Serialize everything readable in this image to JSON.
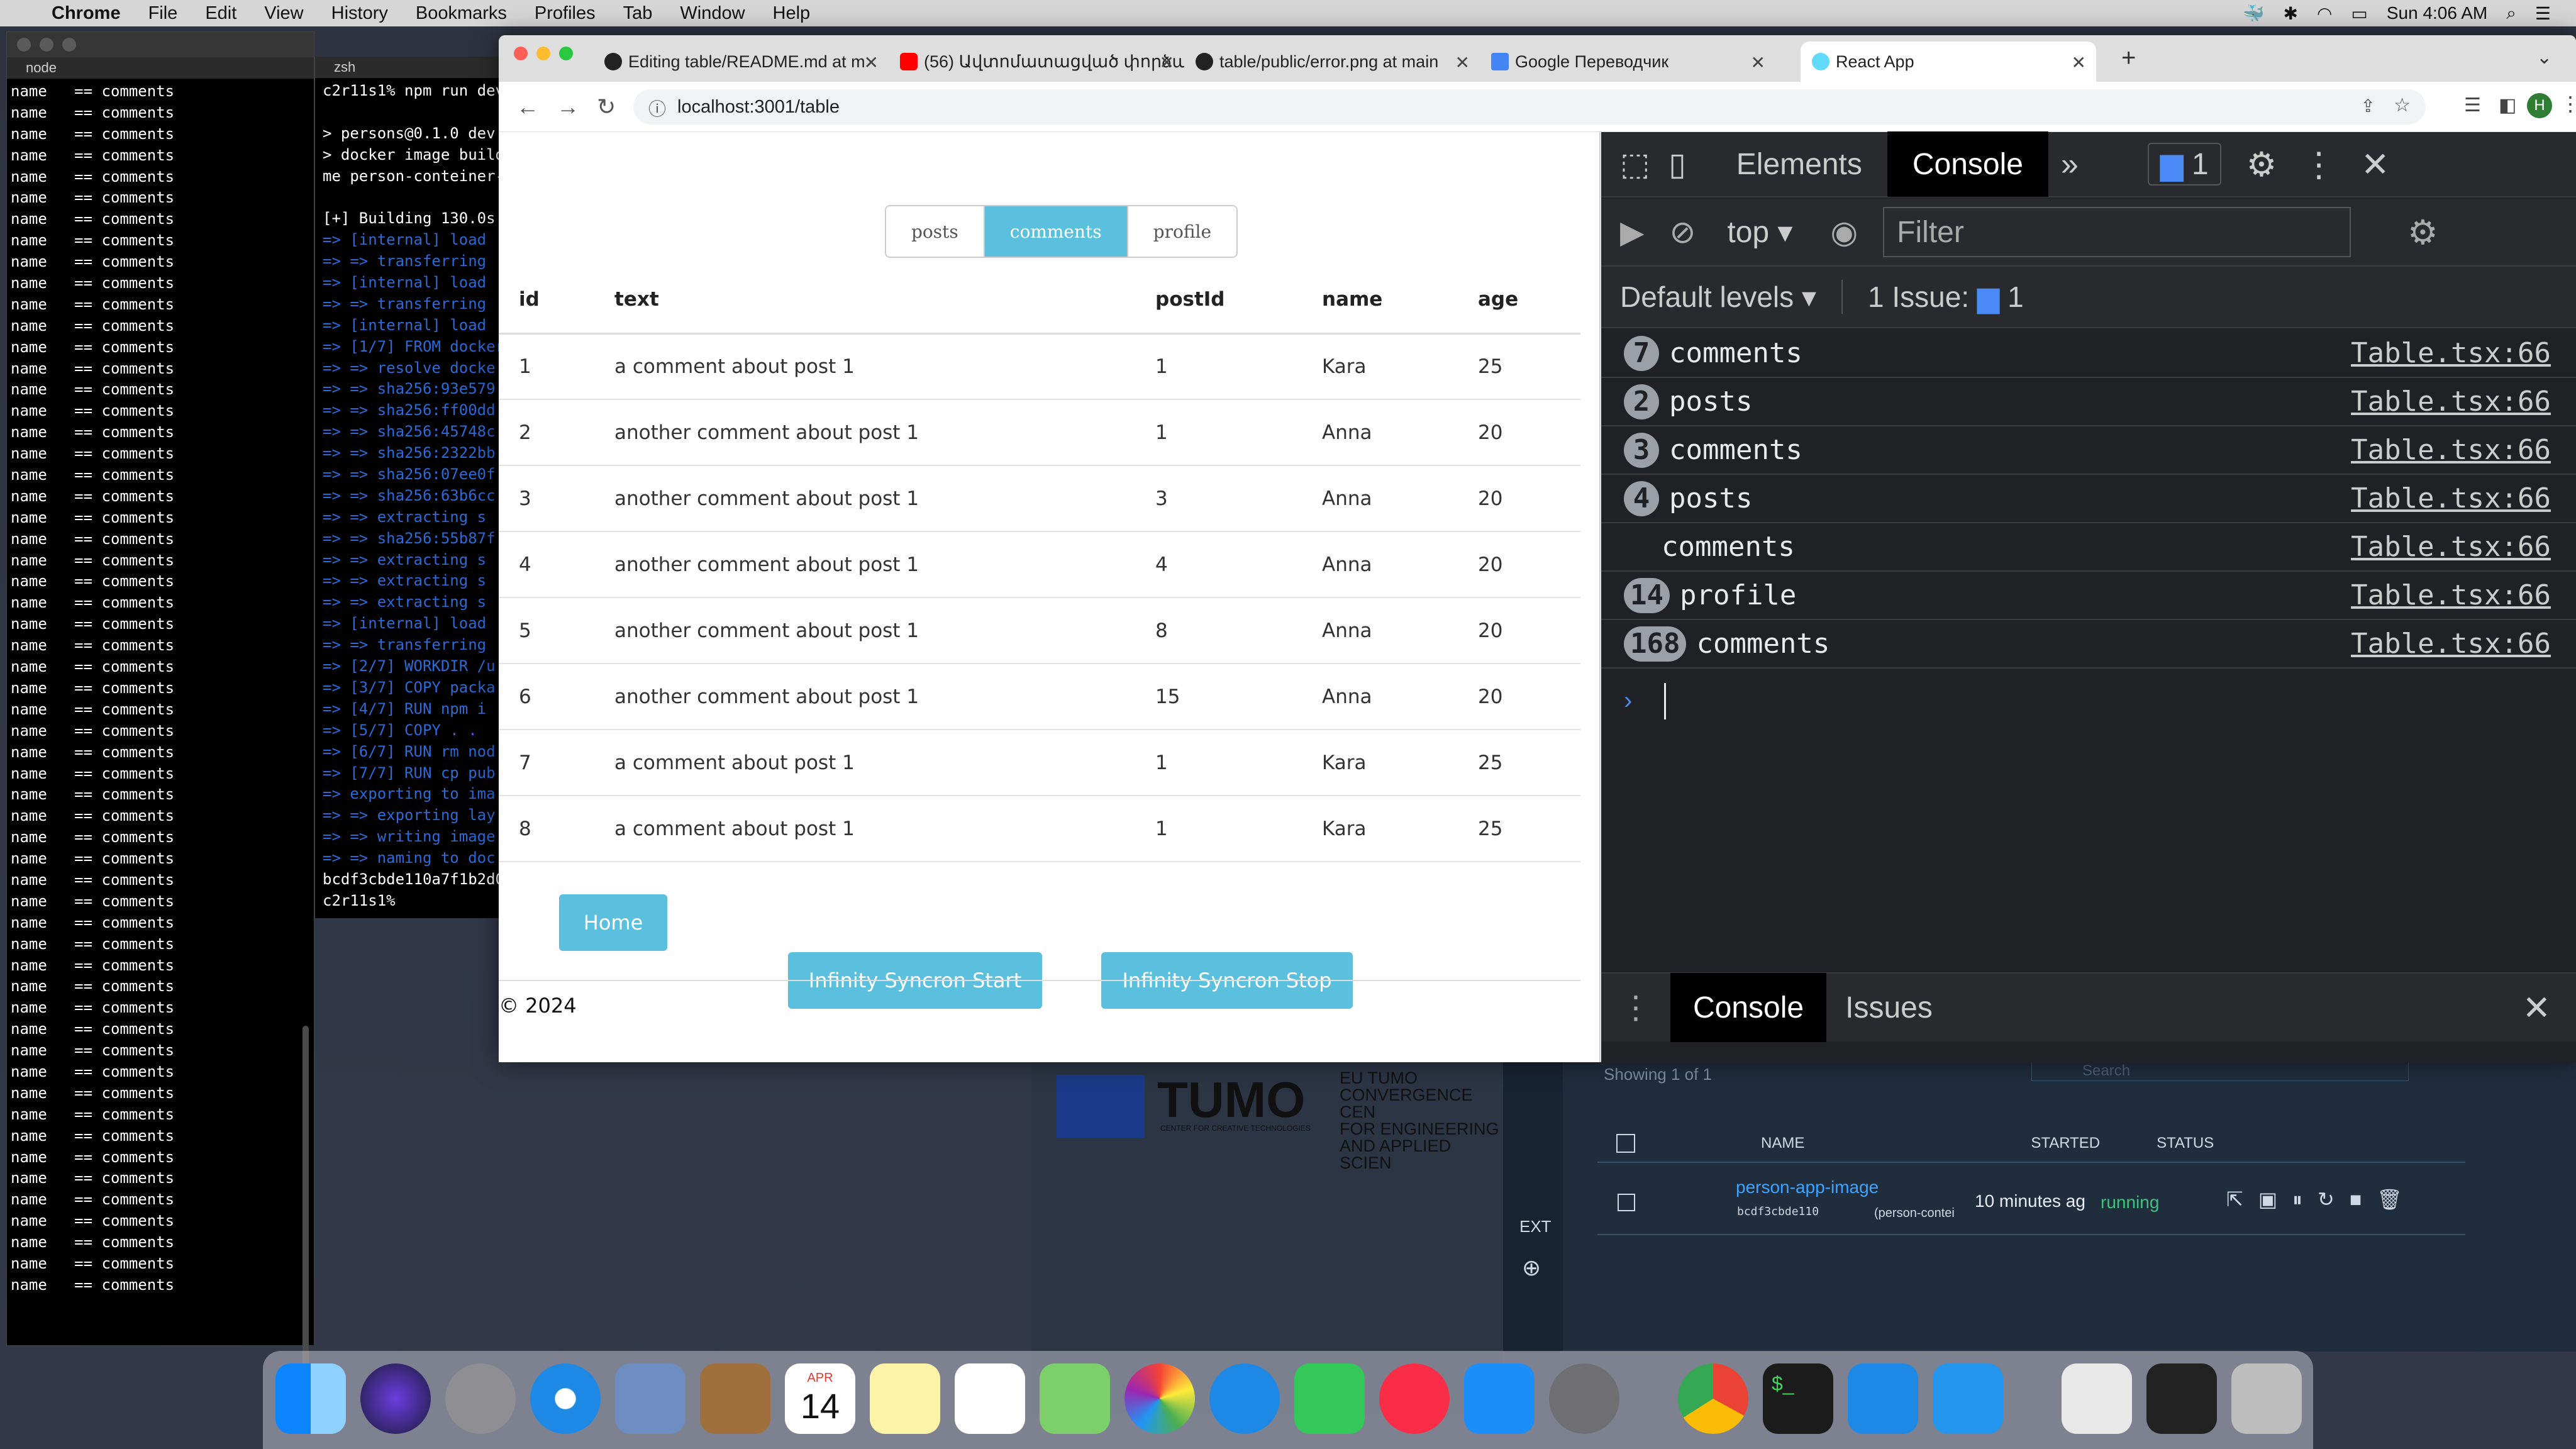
{
  "menubar": {
    "items": [
      "Chrome",
      "File",
      "Edit",
      "View",
      "History",
      "Bookmarks",
      "Profiles",
      "Tab",
      "Window",
      "Help"
    ],
    "clock": "Sun 4:06 AM"
  },
  "terminal1": {
    "title": "node",
    "rows": [
      "name   == comments",
      "name   == comments",
      "name   == comments",
      "name   == comments",
      "name   == comments",
      "name   == comments",
      "name   == comments",
      "name   == comments",
      "name   == comments",
      "name   == comments",
      "name   == comments",
      "name   == comments",
      "name   == comments",
      "name   == comments",
      "name   == comments",
      "name   == comments",
      "name   == comments",
      "name   == comments",
      "name   == comments",
      "name   == comments",
      "name   == comments",
      "name   == comments",
      "name   == comments",
      "name   == comments",
      "name   == comments",
      "name   == comments",
      "name   == comments",
      "name   == comments",
      "name   == comments",
      "name   == comments",
      "name   == comments",
      "name   == comments",
      "name   == comments",
      "name   == comments",
      "name   == comments",
      "name   == comments",
      "name   == comments",
      "name   == comments",
      "name   == comments",
      "name   == comments",
      "name   == comments",
      "name   == comments",
      "name   == comments",
      "name   == comments",
      "name   == comments",
      "name   == comments",
      "name   == comments",
      "name   == comments",
      "name   == comments",
      "name   == comments",
      "name   == comments",
      "name   == comments",
      "name   == comments",
      "name   == comments",
      "name   == comments",
      "name   == comments",
      "name   == comments"
    ]
  },
  "terminal2": {
    "title": "zsh",
    "rows": [
      "c2r11s1% npm run dev",
      "",
      "> persons@0.1.0 dev",
      "> docker image build",
      "me person-conteiner-",
      "",
      "[+] Building 130.0s",
      "=> [internal] load",
      "=> => transferring",
      "=> [internal] load",
      "=> => transferring",
      "=> [internal] load",
      "=> [1/7] FROM docker",
      "=> => resolve docke",
      "=> => sha256:93e579",
      "=> => sha256:ff00dd",
      "=> => sha256:45748c",
      "=> => sha256:2322bb",
      "=> => sha256:07ee0f",
      "=> => sha256:63b6cc",
      "=> => extracting s",
      "=> => sha256:55b87f",
      "=> => extracting s",
      "=> => extracting s",
      "=> => extracting s",
      "=> [internal] load",
      "=> => transferring",
      "=> [2/7] WORKDIR /u",
      "=> [3/7] COPY packa",
      "=> [4/7] RUN npm i",
      "=> [5/7] COPY . .",
      "=> [6/7] RUN rm nod",
      "=> [7/7] RUN cp pub",
      "=> exporting to ima",
      "=> => exporting lay",
      "=> => writing image",
      "=> => naming to doc",
      "bcdf3cbde110a7f1b2d0",
      "c2r11s1% "
    ]
  },
  "browser": {
    "tabs": [
      {
        "label": "Editing table/README.md at m"
      },
      {
        "label": "(56) Ավտոմատացված փորձարկ"
      },
      {
        "label": "table/public/error.png at main"
      },
      {
        "label": "Google Переводчик"
      },
      {
        "label": "React App"
      }
    ],
    "url": "localhost:3001/table"
  },
  "app": {
    "nav_tabs": [
      "posts",
      "comments",
      "profile"
    ],
    "active_tab": "comments",
    "columns": [
      "id",
      "text",
      "postId",
      "name",
      "age"
    ],
    "rows": [
      [
        "1",
        "a comment about post 1",
        "1",
        "Kara",
        "25"
      ],
      [
        "2",
        "another comment about post 1",
        "1",
        "Anna",
        "20"
      ],
      [
        "3",
        "another comment about post 1",
        "3",
        "Anna",
        "20"
      ],
      [
        "4",
        "another comment about post 1",
        "4",
        "Anna",
        "20"
      ],
      [
        "5",
        "another comment about post 1",
        "8",
        "Anna",
        "20"
      ],
      [
        "6",
        "another comment about post 1",
        "15",
        "Anna",
        "20"
      ],
      [
        "7",
        "a comment about post 1",
        "1",
        "Kara",
        "25"
      ],
      [
        "8",
        "a comment about post 1",
        "1",
        "Kara",
        "25"
      ]
    ],
    "home_button": "Home",
    "start_button": "Infinity Syncron Start",
    "stop_button": "Infinity Syncron Stop",
    "footer": "© 2024"
  },
  "devtools": {
    "tabs": [
      "Elements",
      "Console"
    ],
    "active_tab": "Console",
    "issues_count": "1",
    "context": "top",
    "filter_placeholder": "Filter",
    "levels": "Default levels",
    "issues_label": "1 Issue:",
    "issues_badge": "1",
    "logs": [
      {
        "count": "7",
        "text": "comments",
        "source": "Table.tsx:66"
      },
      {
        "count": "2",
        "text": "posts",
        "source": "Table.tsx:66"
      },
      {
        "count": "3",
        "text": "comments",
        "source": "Table.tsx:66"
      },
      {
        "count": "4",
        "text": "posts",
        "source": "Table.tsx:66"
      },
      {
        "count": "",
        "text": "comments",
        "source": "Table.tsx:66"
      },
      {
        "count": "14",
        "text": "profile",
        "source": "Table.tsx:66"
      },
      {
        "count": "168",
        "text": "comments",
        "source": "Table.tsx:66"
      }
    ],
    "bottom_tabs": [
      "Console",
      "Issues"
    ]
  },
  "docker": {
    "showing": "Showing 1 of 1",
    "search_placeholder": "Search",
    "ext_label": "EXT",
    "columns": [
      "NAME",
      "STARTED",
      "STATUS"
    ],
    "container_name": "person-app-image",
    "container_id": "bcdf3cbde110",
    "container_image": "(person-contei",
    "started": "10 minutes ag",
    "status": "running"
  },
  "tumo": {
    "logo": "TUMO",
    "sub": "CENTER FOR CREATIVE TECHNOLOGIES",
    "lines": [
      "EU TUMO",
      "CONVERGENCE CEN",
      "FOR ENGINEERING",
      "AND APPLIED SCIEN"
    ]
  },
  "dock": {
    "calendar_month": "APR",
    "calendar_day": "14"
  },
  "colors": {
    "accent": "#5bc0de",
    "devtools_bg": "#202124",
    "badge": "#9aa0a6"
  }
}
